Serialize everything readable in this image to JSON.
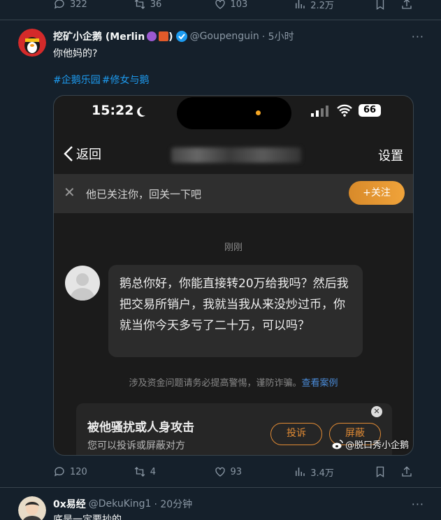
{
  "prev_tweet": {
    "replies": "322",
    "retweets": "36",
    "likes": "103",
    "views": "2.2万"
  },
  "tweet": {
    "author_name": "挖矿小企鹅 (Merlin",
    "author_name_end": ")",
    "handle": "@Goupenguin",
    "time": "· 5小时",
    "text": "你他妈的?",
    "hashtags": [
      "#企鹅乐园",
      "#修女与鹅"
    ],
    "replies": "120",
    "retweets": "4",
    "likes": "93",
    "views": "3.4万",
    "more": "···"
  },
  "screenshot": {
    "clock": "15:22",
    "battery": "66",
    "back_label": "返回",
    "settings_label": "设置",
    "follow_prompt": "他已关注你，回关一下吧",
    "follow_button": "+关注",
    "timestamp": "刚刚",
    "message": "鹅总你好，你能直接转20万给我吗？然后我把交易所销户，我就当我从来没炒过币，你就当你今天多亏了二十万，可以吗？",
    "warning_text": "涉及资金问题请务必提高警惕，谨防诈骗。",
    "warning_link": "查看案例",
    "report_title": "被他骚扰或人身攻击",
    "report_sub": "您可以投诉或屏蔽对方",
    "complain_button": "投诉",
    "block_button": "屏蔽",
    "watermark": "@脱口秀小企鹅"
  },
  "next_tweet": {
    "author_name": "0x易经",
    "handle": "@DekuKing1",
    "time": "· 20分钟",
    "text": "底是一定要抄的",
    "more": "···"
  },
  "colors": {
    "background": "#15202b",
    "accent": "#1d9bf0",
    "verified": "#1d9bf0",
    "follow_button": "#f0a33a"
  }
}
